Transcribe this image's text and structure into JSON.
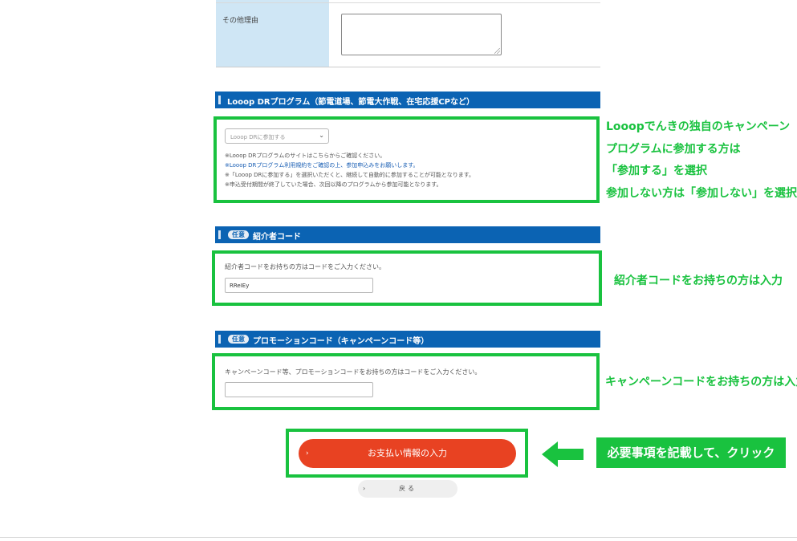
{
  "other_reason": {
    "label": "その他理由",
    "value": ""
  },
  "looop_section": {
    "title": "Looop DRプログラム（節電道場、節電大作戦、在宅応援CPなど）",
    "select_value": "Looop DRに参加する",
    "notes": [
      "※Looop DRプログラムのサイトはこちらからご確認ください。",
      "※Looop DRプログラム利用規約をご確認の上、参加申込みをお願いします。",
      "※「Looop DRに参加する」を選択いただくと、継続して自動的に参加することが可能となります。",
      "※申込受付期間が終了していた場合、次回以降のプログラムから参加可能となります。"
    ]
  },
  "referrer_section": {
    "badge": "任意",
    "title": "紹介者コード",
    "hint": "紹介者コードをお持ちの方はコードをご入力ください。",
    "value": "RReIEy"
  },
  "promo_section": {
    "badge": "任意",
    "title": "プロモーションコード（キャンペーンコード等）",
    "hint": "キャンペーンコード等、プロモーションコードをお持ちの方はコードをご入力ください。",
    "value": ""
  },
  "callouts": {
    "looop": [
      "Looopでんきの独自のキャンペーン",
      "プログラムに参加する方は",
      "「参加する」を選択",
      "参加しない方は「参加しない」を選択"
    ],
    "referrer": "紹介者コードをお持ちの方は入力",
    "promo": "キャンペーンコードをお持ちの方は入力",
    "action": "必要事項を記載して、クリック"
  },
  "buttons": {
    "pay": "お支払い情報の入力",
    "back": "戻る"
  },
  "colors": {
    "highlight": "#19c23f",
    "section_bar": "#0b63b3",
    "primary_button": "#e84222"
  }
}
